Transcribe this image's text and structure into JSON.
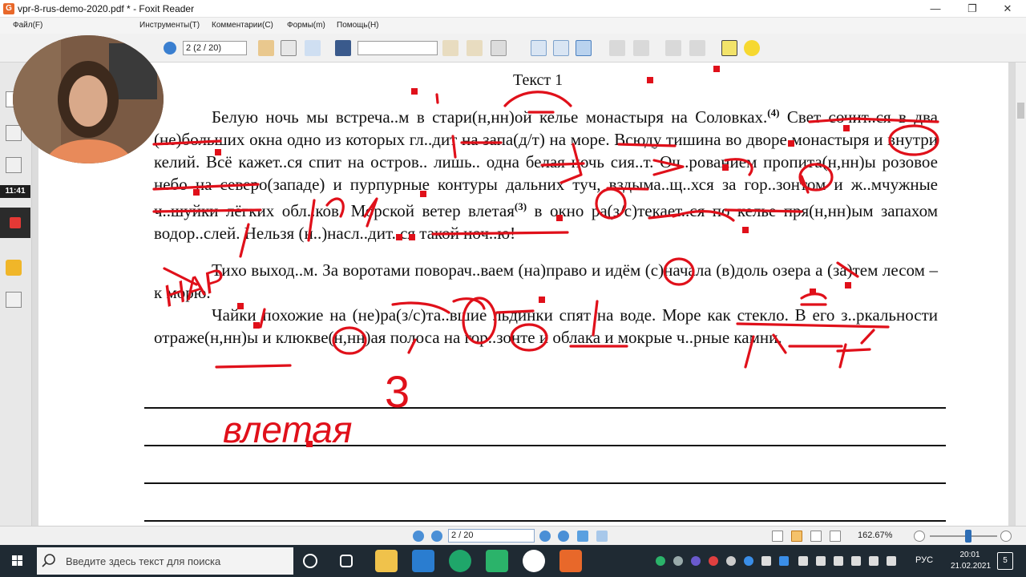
{
  "window": {
    "title": "vpr-8-rus-demo-2020.pdf * - Foxit Reader",
    "app_logo": "G",
    "minimize": "—",
    "maximize": "❐",
    "close": "✕"
  },
  "menu": [
    "Файл(F)",
    "Инструменты(T)",
    "Комментарии(C)",
    "Формы(m)",
    "Помощь(H)"
  ],
  "toolbar": {
    "page_value": "2 (2 / 20)",
    "find_value": ""
  },
  "recorder": {
    "time": "11:41"
  },
  "document": {
    "title": "Текст 1",
    "paragraph1": "Белую ночь мы встреча..м в стари(н,нн)ой келье монастыря на Соловках.",
    "paragraph1_note": "(4)",
    "paragraph1_cont": " Свет сочит..ся в два (не)больших окна одно из которых гл..дит на запа(д/т) на море. Всюду тишина во дворе монастыря и внутри келий. Всё кажет..ся спит на остров.. лишь.. одна белая ночь сия..т. Оч..рованием пропита(н,нн)ы розовое небо на северо(западе) и пурпурные контуры дальних туч, вздыма..щ..хся за гор..зонтом и ж..мчужные ч..шуйки лёгких обл..ков. Морской ветер влетая",
    "paragraph1_note2": "(3)",
    "paragraph1_end": " в окно ра(з/с)текает..ся по келье пря(н,нн)ым запахом водор..слей. Нельзя (н..)насл..дит..ся такой ноч..ю!",
    "paragraph2": "Тихо выход..м. За воротами поворач..ваем (на)право и идём (с)начала (в)доль озера а (за)тем лесом – к морю.",
    "paragraph3": "Чайки похожие на (не)ра(з/с)та..вшие льдинки спят на воде. Море как стекло. В его з..ркальности отраже(н,нн)ы и клюкве(н,нн)ая полоса на гор..зонте и облака и мокрые ч..рные камни."
  },
  "annotations": {
    "big_number": "3",
    "handwriting": "влетая",
    "side_text": "НАР"
  },
  "statusbar": {
    "page_value": "2 / 20",
    "zoom": "162.67%"
  },
  "taskbar": {
    "search_placeholder": "Введите здесь текст для поиска",
    "language": "РУС",
    "time": "20:01",
    "date": "21.02.2021",
    "notification_count": "5"
  },
  "colors": {
    "annotation_red": "#e0101a",
    "foxit_orange": "#e8682a",
    "taskbar": "#1f2a33"
  }
}
